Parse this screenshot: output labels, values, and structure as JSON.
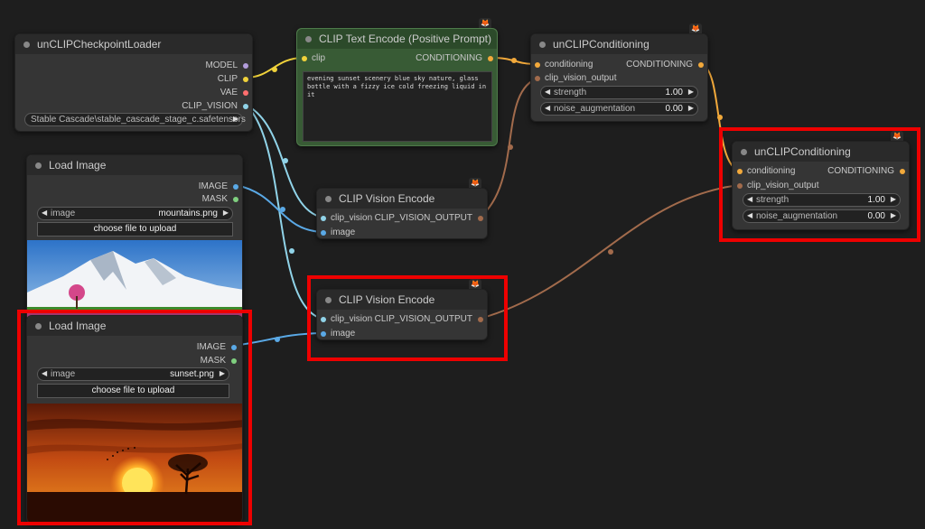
{
  "colors": {
    "clip": "#f0d23b",
    "conditioning": "#f2a93b",
    "clip_vision": "#90d3e8",
    "image": "#5aa9e6",
    "clip_vision_output": "#a26b4c",
    "model": "#b39ddb",
    "vae": "#ff6e6e",
    "mask": "#7fcf7f",
    "highlight": "#ee0000"
  },
  "checkpoint_loader": {
    "title": "unCLIPCheckpointLoader",
    "outputs": [
      "MODEL",
      "CLIP",
      "VAE",
      "CLIP_VISION"
    ],
    "ckpt_value": "Stable Cascade\\stable_cascade_stage_c.safetensors"
  },
  "text_encode": {
    "title": "CLIP Text Encode (Positive Prompt)",
    "input": "clip",
    "output": "CONDITIONING",
    "text": "evening sunset scenery blue sky nature, glass bottle with a fizzy ice cold freezing liquid in it"
  },
  "uncond1": {
    "title": "unCLIPConditioning",
    "inputs": [
      "conditioning",
      "clip_vision_output"
    ],
    "output": "CONDITIONING",
    "strength_label": "strength",
    "strength_value": "1.00",
    "noise_label": "noise_augmentation",
    "noise_value": "0.00"
  },
  "uncond2": {
    "title": "unCLIPConditioning",
    "inputs": [
      "conditioning",
      "clip_vision_output"
    ],
    "output": "CONDITIONING",
    "strength_label": "strength",
    "strength_value": "1.00",
    "noise_label": "noise_augmentation",
    "noise_value": "0.00"
  },
  "vision_encode1": {
    "title": "CLIP Vision Encode",
    "inputs": [
      "clip_vision",
      "image"
    ],
    "output": "CLIP_VISION_OUTPUT"
  },
  "vision_encode2": {
    "title": "CLIP Vision Encode",
    "inputs": [
      "clip_vision",
      "image"
    ],
    "output": "CLIP_VISION_OUTPUT"
  },
  "load_image1": {
    "title": "Load Image",
    "outputs": [
      "IMAGE",
      "MASK"
    ],
    "image_label": "image",
    "image_value": "mountains.png",
    "upload_label": "choose file to upload"
  },
  "load_image2": {
    "title": "Load Image",
    "outputs": [
      "IMAGE",
      "MASK"
    ],
    "image_label": "image",
    "image_value": "sunset.png",
    "upload_label": "choose file to upload"
  }
}
